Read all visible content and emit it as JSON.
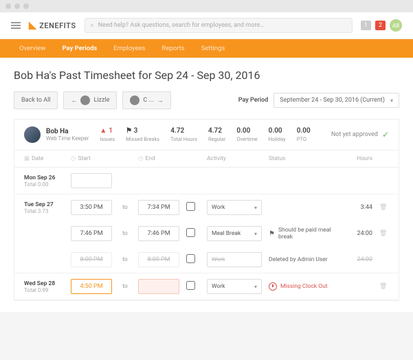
{
  "brand": "ZENEFITS",
  "search": {
    "placeholder": "Need help? Ask questions, search for employees, and more..."
  },
  "badges": {
    "gray": "1",
    "red": "2"
  },
  "avatar_initials": "AB",
  "nav": {
    "overview": "Overview",
    "pay_periods": "Pay Periods",
    "employees": "Employees",
    "reports": "Reports",
    "settings": "Settings"
  },
  "title": "Bob Ha's Past Timesheet for Sep 24 - Sep 30, 2016",
  "back_btn": "Back to All",
  "peer1": "Lizzle",
  "peer2": "C ...",
  "period_label": "Pay Period",
  "period_value": "September 24 - Sep 30, 2016 (Current)",
  "employee": {
    "name": "Bob Ha",
    "role": "Web Time Keeper"
  },
  "stats": {
    "issues_val": "1",
    "issues_lbl": "Issues",
    "missed_val": "3",
    "missed_lbl": "Missed Breaks",
    "total_val": "4.72",
    "total_lbl": "Total Hours",
    "regular_val": "4.72",
    "regular_lbl": "Regular",
    "overtime_val": "0.00",
    "overtime_lbl": "Overtime",
    "holiday_val": "0.00",
    "holiday_lbl": "Holiday",
    "pto_val": "0.00",
    "pto_lbl": "PTO"
  },
  "approval": "Not yet approved",
  "headers": {
    "date": "Date",
    "start": "Start",
    "end": "End",
    "activity": "Activity",
    "status": "Status",
    "hours": "Hours"
  },
  "to": "to",
  "days": {
    "mon": {
      "name": "Mon Sep 26",
      "total": "0.00"
    },
    "tue": {
      "name": "Tue Sep 27",
      "total": "3.73",
      "r1": {
        "start": "3:50 PM",
        "end": "7:34 PM",
        "activity": "Work",
        "hours": "3:44"
      },
      "r2": {
        "start": "7:46 PM",
        "end": "7:46 PM",
        "activity": "Meal Break",
        "status": "Should be paid meal break",
        "hours": "24:00"
      },
      "r3": {
        "start": "8:00 PM",
        "end": "8:00 PM",
        "activity": "Work",
        "status": "Deleted by Admin User",
        "hours": "24:00"
      }
    },
    "wed": {
      "name": "Wed Sep 28",
      "total": "0.99",
      "r1": {
        "start": "4:50 PM",
        "end": "",
        "activity": "Work",
        "status": "Missing Clock Out"
      }
    }
  },
  "total_lbl": "Total"
}
